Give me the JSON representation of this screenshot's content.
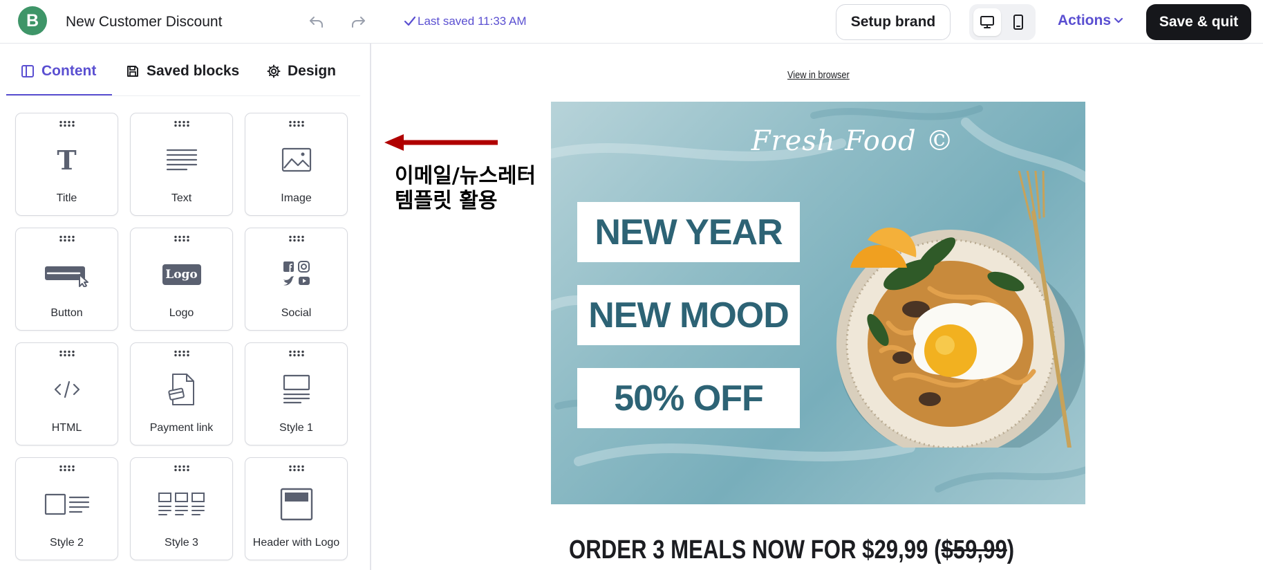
{
  "app": {
    "logo_letter": "B",
    "title": "New Customer Discount",
    "saved_status": "Last saved 11:33 AM"
  },
  "header": {
    "setup_brand_label": "Setup brand",
    "actions_label": "Actions",
    "save_quit_label": "Save & quit",
    "active_device": "desktop"
  },
  "left_panel": {
    "tabs": [
      {
        "label": "Content",
        "icon": "layout-icon",
        "active": true
      },
      {
        "label": "Saved blocks",
        "icon": "save-icon",
        "active": false
      },
      {
        "label": "Design",
        "icon": "gear-icon",
        "active": false
      }
    ],
    "blocks": [
      {
        "label": "Title",
        "icon": "title-icon"
      },
      {
        "label": "Text",
        "icon": "text-icon"
      },
      {
        "label": "Image",
        "icon": "image-icon"
      },
      {
        "label": "Button",
        "icon": "button-icon"
      },
      {
        "label": "Logo",
        "icon": "logo-icon"
      },
      {
        "label": "Social",
        "icon": "social-icon"
      },
      {
        "label": "HTML",
        "icon": "code-icon"
      },
      {
        "label": "Payment link",
        "icon": "payment-link-icon"
      },
      {
        "label": "Style 1",
        "icon": "style1-icon"
      },
      {
        "label": "Style 2",
        "icon": "style2-icon"
      },
      {
        "label": "Style 3",
        "icon": "style3-icon"
      },
      {
        "label": "Header with Logo",
        "icon": "header-logo-icon"
      }
    ],
    "title_glyph": "T",
    "logo_glyph": "Logo"
  },
  "email": {
    "view_in_browser": "View in browser",
    "brand": "Fresh Food ©",
    "promo_lines": [
      "NEW YEAR",
      "NEW MOOD",
      "50% OFF"
    ],
    "offer_text": "ORDER 3 MEALS NOW FOR $29,99 (",
    "offer_old_price": "$59,99",
    "offer_close": ")"
  },
  "annotation": {
    "line1": "이메일/뉴스레터",
    "line2": "템플릿 활용"
  },
  "colors": {
    "accent": "#5a4fd1",
    "brand_green": "#3e9568",
    "save_button": "#16171b",
    "promo_text": "#2d6375",
    "annotation_arrow": "#b00000"
  }
}
